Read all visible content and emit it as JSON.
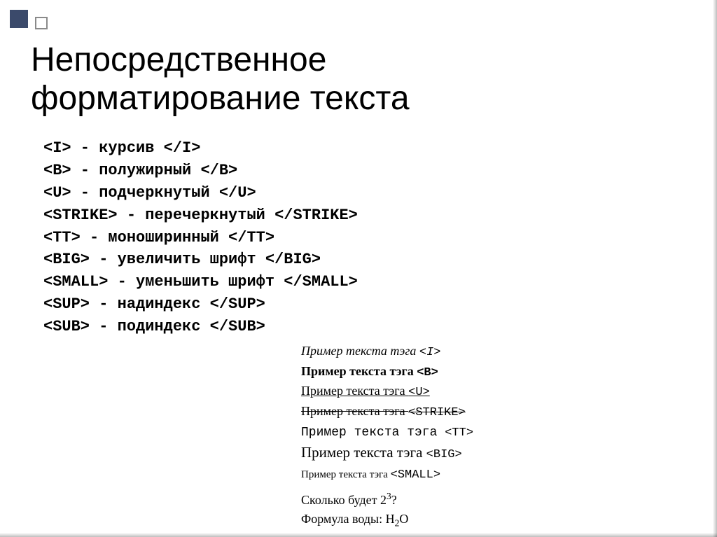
{
  "title_line1": "Непосредственное",
  "title_line2": "форматирование текста",
  "tags": [
    {
      "open": "<I>",
      "desc": " - курсив ",
      "close": "</I>"
    },
    {
      "open": "<B>",
      "desc": " - полужирный ",
      "close": "</B>"
    },
    {
      "open": "<U>",
      "desc": " - подчеркнутый ",
      "close": "</U>"
    },
    {
      "open": "<STRIKE>",
      "desc": " - перечеркнутый ",
      "close": "</STRIKE>"
    },
    {
      "open": "<TT>",
      "desc": " - моноширинный ",
      "close": "</TT>"
    },
    {
      "open": "<BIG>",
      "desc": " - увеличить шрифт ",
      "close": "</BIG>"
    },
    {
      "open": "<SMALL>",
      "desc": " - уменьшить шрифт ",
      "close": "</SMALL>"
    },
    {
      "open": "<SUP>",
      "desc": " - надиндекс ",
      "close": "</SUP>"
    },
    {
      "open": "<SUB>",
      "desc": " - подиндекс ",
      "close": "</SUB>"
    }
  ],
  "examples": {
    "prefix": "Пример текста тэга ",
    "i_tag": "<I>",
    "b_tag": "<B>",
    "u_tag": "<U>",
    "strike_tag": "<STRIKE>",
    "tt_tag": "<TT>",
    "big_tag": "<BIG>",
    "small_tag": "<SMALL>",
    "sup_q_pre": "Сколько будет 2",
    "sup_exp": "3",
    "sup_q_post": "?",
    "sub_pre": "Формула воды: H",
    "sub_idx": "2",
    "sub_post": "O"
  }
}
